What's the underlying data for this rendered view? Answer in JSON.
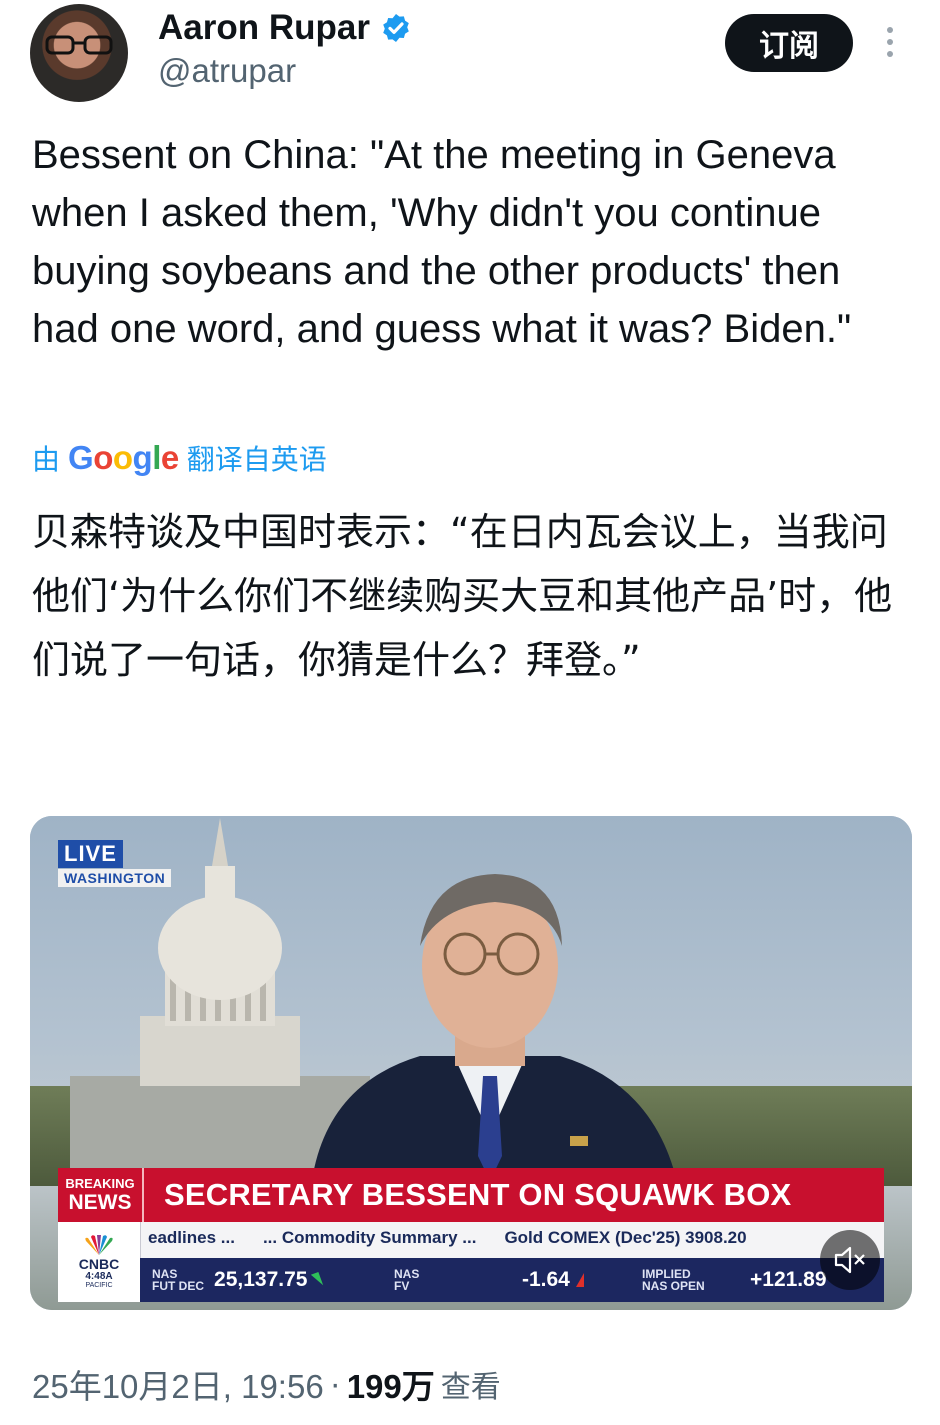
{
  "author": {
    "name": "Aaron Rupar",
    "handle": "@atrupar",
    "verified_icon": "verified-badge-icon"
  },
  "header": {
    "subscribe_label": "订阅",
    "more_icon": "more-vertical-icon"
  },
  "tweet": {
    "text": "Bessent on China: \"At the meeting in Geneva when I asked them, 'Why didn't you continue buying soybeans and the other products' then had one word, and guess what it was? Biden.\"",
    "translation_prefix": "由",
    "translation_provider": "Google",
    "translation_suffix": "翻译自英语",
    "translated_text": "贝森特谈及中国时表示：“在日内瓦会议上，当我问他们‘为什么你们不继续购买大豆和其他产品’时，他们说了一句话，你猜是什么？拜登。”"
  },
  "video": {
    "live_label": "LIVE",
    "live_location": "WASHINGTON",
    "breaking_line1": "BREAKING",
    "breaking_line2": "NEWS",
    "headline": "SECRETARY BESSENT ON SQUAWK BOX",
    "network": "CNBC",
    "local_time": "4:48A",
    "time_zone": "PACIFIC",
    "crawl": [
      "eadlines ...",
      "... Commodity Summary ...",
      "Gold COMEX (Dec'25) 3908.20"
    ],
    "quotes": [
      {
        "label1": "NAS",
        "label2": "FUT",
        "sub": "DEC",
        "value": "25,137.75",
        "direction": "down"
      },
      {
        "label1": "NAS",
        "label2": "FV",
        "sub": "",
        "value": "-1.64",
        "direction": "up"
      },
      {
        "label1": "IMPLIED",
        "label2": "NAS OPEN",
        "sub": "",
        "value": "+121.89",
        "direction": "none"
      }
    ],
    "mute_icon": "mute-speaker-icon"
  },
  "footer": {
    "date": "25年10月2日, 19:56",
    "separator": "·",
    "views": "199万",
    "views_label": "查看"
  },
  "colors": {
    "accent": "#1d9bf0",
    "text": "#0f1419",
    "muted": "#536471",
    "banner_red": "#c8102e",
    "ticker_navy": "#1c2760"
  }
}
